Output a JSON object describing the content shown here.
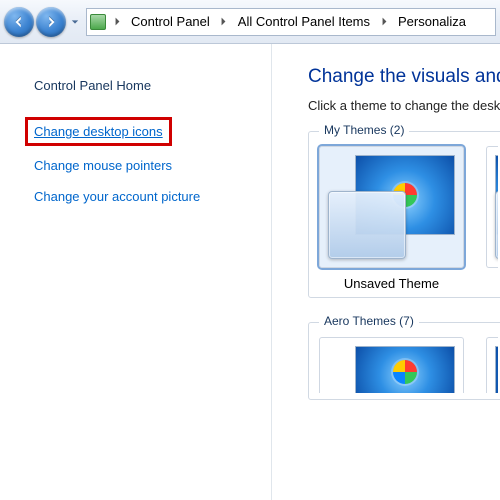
{
  "breadcrumb": {
    "items": [
      "Control Panel",
      "All Control Panel Items",
      "Personaliza"
    ]
  },
  "sidebar": {
    "title": "Control Panel Home",
    "links": [
      "Change desktop icons",
      "Change mouse pointers",
      "Change your account picture"
    ]
  },
  "content": {
    "heading": "Change the visuals and so",
    "subheading": "Click a theme to change the deskt"
  },
  "groups": {
    "my": {
      "title": "My Themes (2)",
      "items": [
        {
          "label": "Unsaved Theme"
        }
      ]
    },
    "aero": {
      "title": "Aero Themes (7)"
    }
  }
}
